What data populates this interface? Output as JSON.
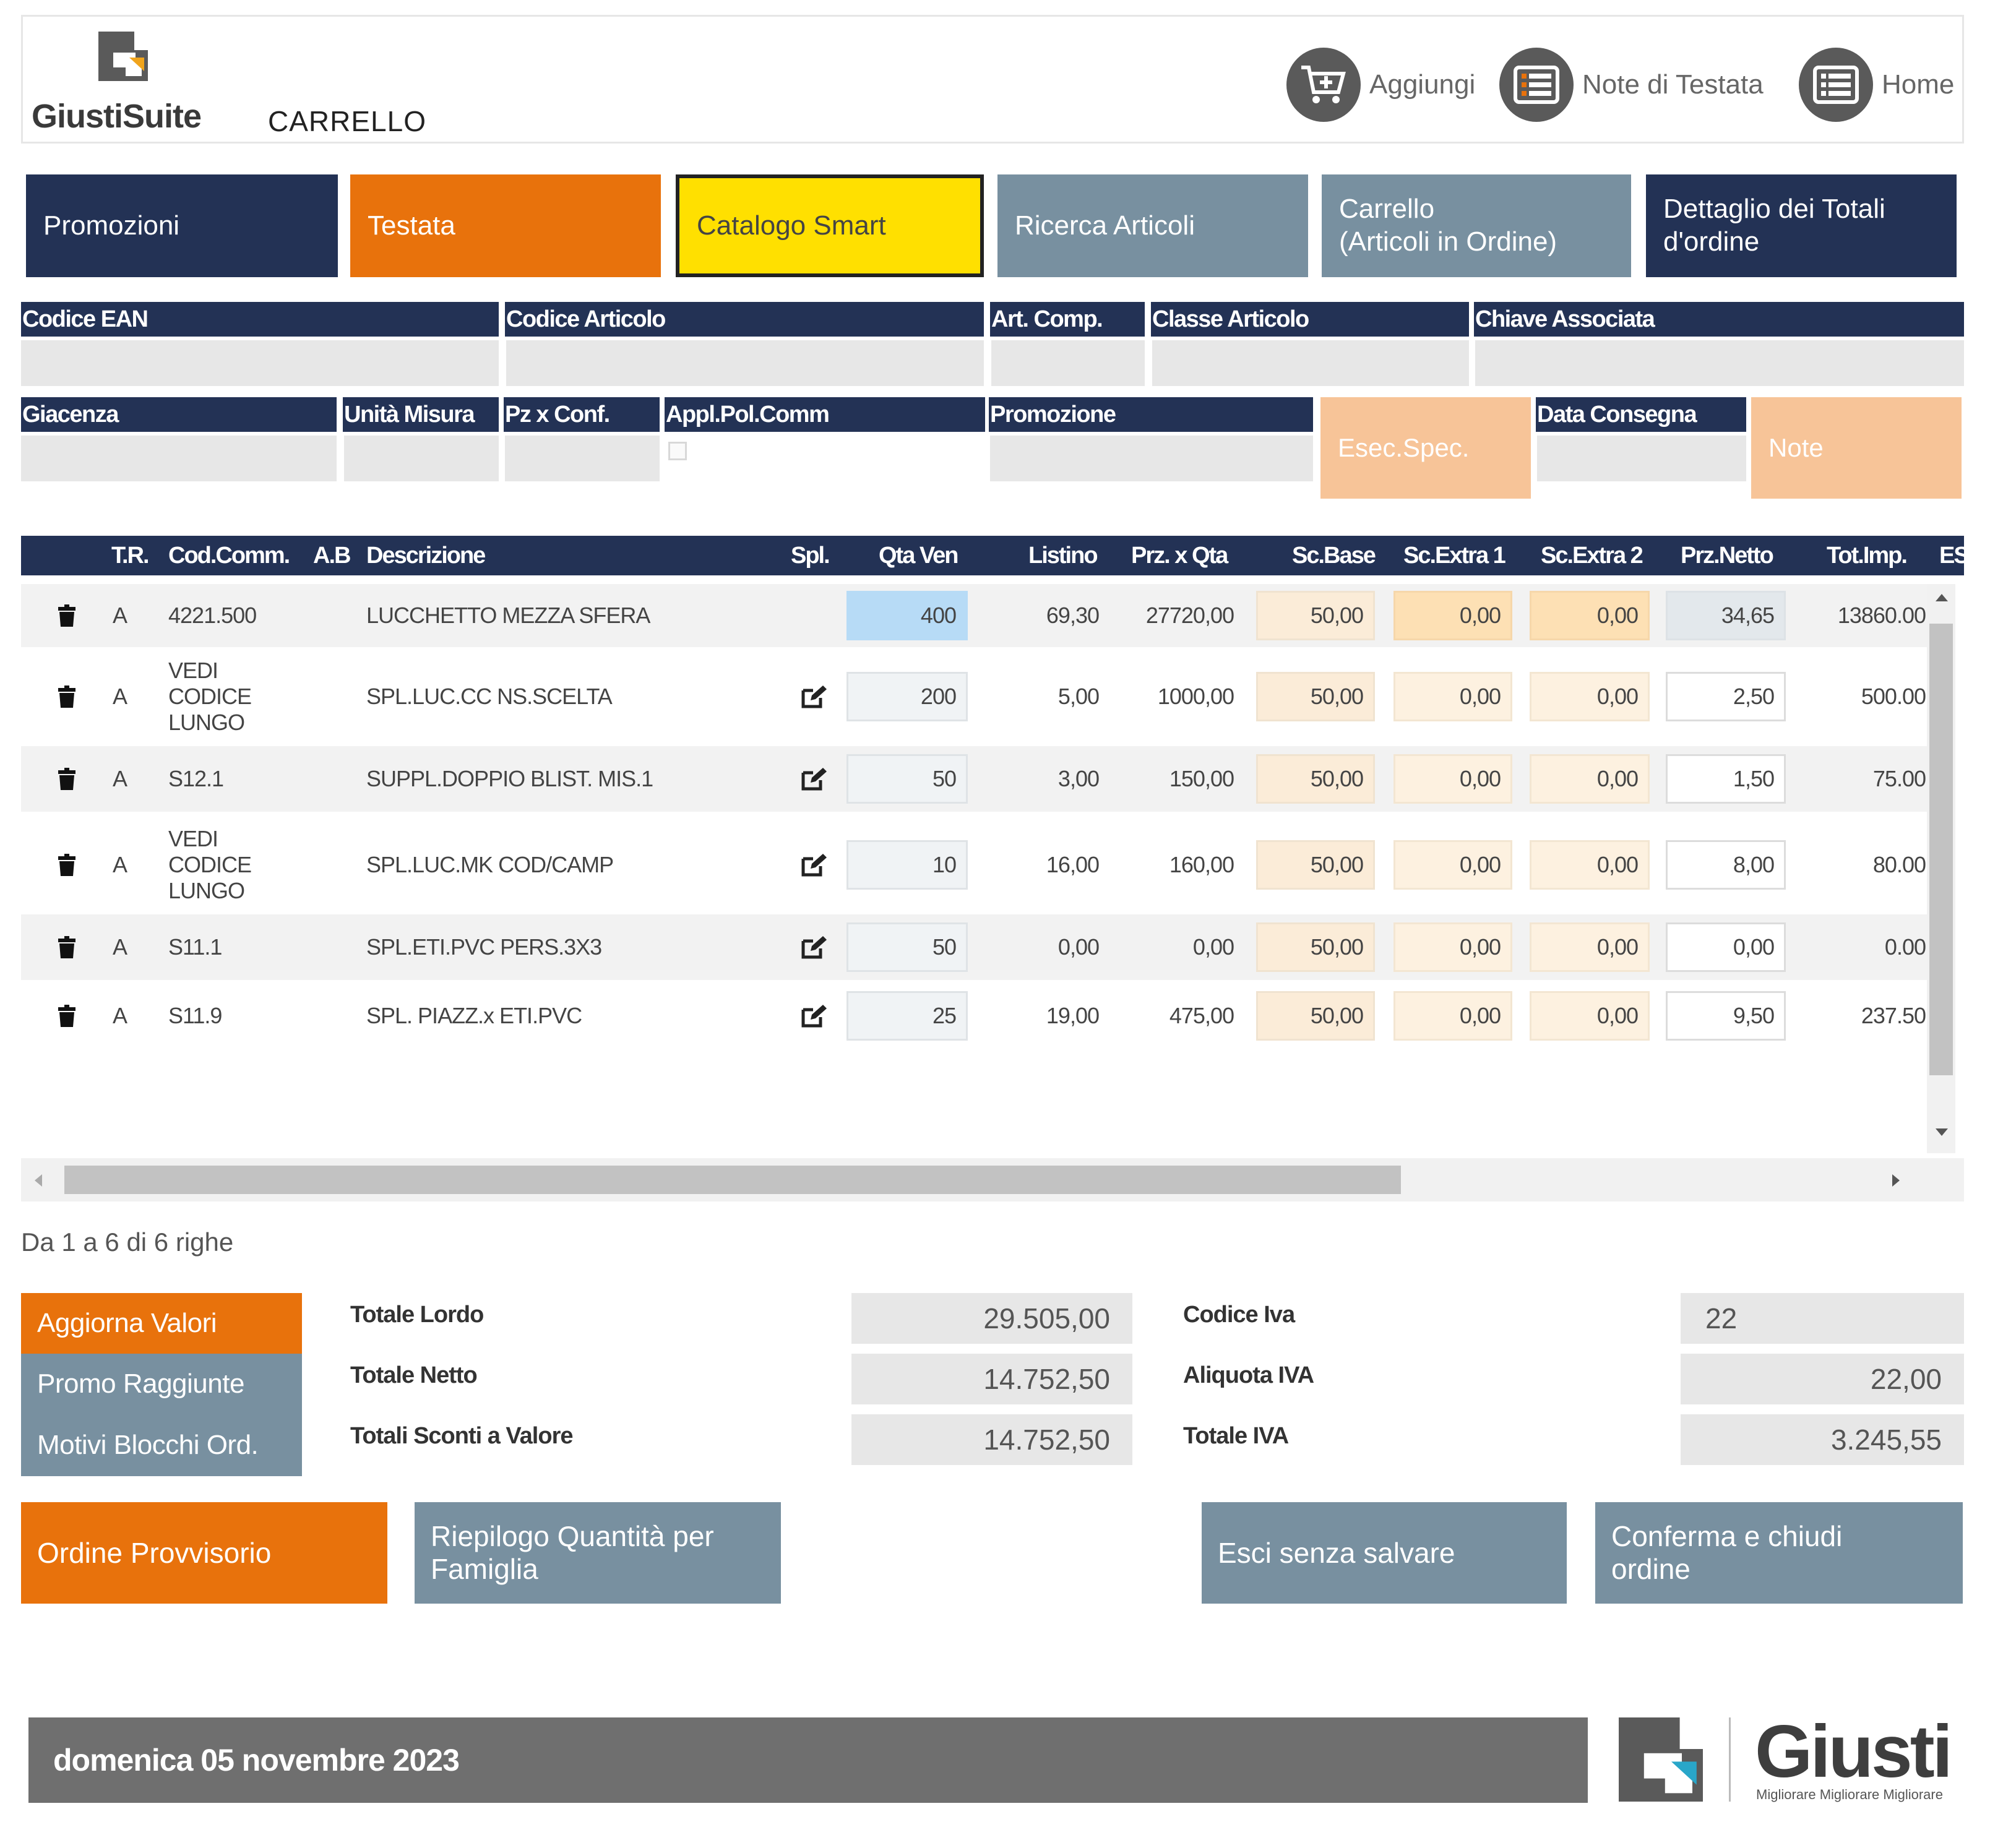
{
  "header": {
    "brand": "GiustiSuite",
    "page_title": "CARRELLO",
    "buttons": [
      {
        "label": "Aggiungi",
        "icon": "cart-add-icon"
      },
      {
        "label": "Note di Testata",
        "icon": "list-icon"
      },
      {
        "label": "Home",
        "icon": "list-icon"
      }
    ]
  },
  "tabs": [
    {
      "label": "Promozioni",
      "color": "#233255"
    },
    {
      "label": "Testata",
      "color": "#e8720c"
    },
    {
      "label": "Catalogo Smart",
      "color": "#ffe000"
    },
    {
      "label": "Ricerca Articoli",
      "color": "#7890a0"
    },
    {
      "label": "Carrello\n(Articoli in Ordine)",
      "color": "#7890a0"
    },
    {
      "label": "Dettaglio dei Totali\nd'ordine",
      "color": "#233255"
    }
  ],
  "fields": {
    "row1": [
      "Codice EAN",
      "Codice Articolo",
      "Art. Comp.",
      "Classe Articolo",
      "Chiave Associata"
    ],
    "row2": [
      "Giacenza",
      "Unità Misura",
      "Pz x Conf.",
      "Appl.Pol.Comm",
      "Promozione",
      "Data Consegna"
    ],
    "esec_spec": "Esec.Spec.",
    "note": "Note"
  },
  "table": {
    "columns": [
      "T.R.",
      "Cod.Comm.",
      "A.B",
      "Descrizione",
      "Spl.",
      "Qta Ven",
      "Listino",
      "Prz. x Qta",
      "Sc.Base",
      "Sc.Extra 1",
      "Sc.Extra 2",
      "Prz.Netto",
      "Tot.Imp.",
      "ES"
    ],
    "rows": [
      {
        "tr": "A",
        "cod": "4221.500",
        "desc": "LUCCHETTO MEZZA SFERA",
        "spl": false,
        "qta": "400",
        "listino": "69,30",
        "prz": "27720,00",
        "base": "50,00",
        "ext1": "0,00",
        "ext2": "0,00",
        "netto": "34,65",
        "tot": "13860.00"
      },
      {
        "tr": "A",
        "cod": "VEDI\nCODICE\nLUNGO",
        "desc": "SPL.LUC.CC NS.SCELTA",
        "spl": true,
        "qta": "200",
        "listino": "5,00",
        "prz": "1000,00",
        "base": "50,00",
        "ext1": "0,00",
        "ext2": "0,00",
        "netto": "2,50",
        "tot": "500.00"
      },
      {
        "tr": "A",
        "cod": "S12.1",
        "desc": "SUPPL.DOPPIO BLIST. MIS.1",
        "spl": true,
        "qta": "50",
        "listino": "3,00",
        "prz": "150,00",
        "base": "50,00",
        "ext1": "0,00",
        "ext2": "0,00",
        "netto": "1,50",
        "tot": "75.00"
      },
      {
        "tr": "A",
        "cod": "VEDI\nCODICE\nLUNGO",
        "desc": "SPL.LUC.MK COD/CAMP",
        "spl": true,
        "qta": "10",
        "listino": "16,00",
        "prz": "160,00",
        "base": "50,00",
        "ext1": "0,00",
        "ext2": "0,00",
        "netto": "8,00",
        "tot": "80.00"
      },
      {
        "tr": "A",
        "cod": "S11.1",
        "desc": "SPL.ETI.PVC PERS.3X3",
        "spl": true,
        "qta": "50",
        "listino": "0,00",
        "prz": "0,00",
        "base": "50,00",
        "ext1": "0,00",
        "ext2": "0,00",
        "netto": "0,00",
        "tot": "0.00"
      },
      {
        "tr": "A",
        "cod": "S11.9",
        "desc": "SPL. PIAZZ.x ETI.PVC",
        "spl": true,
        "qta": "25",
        "listino": "19,00",
        "prz": "475,00",
        "base": "50,00",
        "ext1": "0,00",
        "ext2": "0,00",
        "netto": "9,50",
        "tot": "237.50"
      }
    ],
    "pager": "Da 1 a 6 di 6 righe"
  },
  "side_buttons": [
    {
      "label": "Aggiorna Valori",
      "color": "#e8720c"
    },
    {
      "label": "Promo Raggiunte",
      "color": "#7890a0"
    },
    {
      "label": "Motivi Blocchi Ord.",
      "color": "#7890a0"
    }
  ],
  "totals": {
    "totale_lordo_label": "Totale Lordo",
    "totale_lordo": "29.505,00",
    "totale_netto_label": "Totale Netto",
    "totale_netto": "14.752,50",
    "sconti_label": "Totali Sconti a Valore",
    "sconti": "14.752,50",
    "codice_iva_label": "Codice Iva",
    "codice_iva": "22",
    "aliquota_label": "Aliquota IVA",
    "aliquota": "22,00",
    "totale_iva_label": "Totale IVA",
    "totale_iva": "3.245,55"
  },
  "actions": [
    {
      "label": "Ordine Provvisorio",
      "color": "#e8720c"
    },
    {
      "label": "Riepilogo Quantità per\nFamiglia",
      "color": "#7890a0"
    },
    {
      "label": "Esci senza salvare",
      "color": "#7890a0"
    },
    {
      "label": "Conferma e chiudi\nordine",
      "color": "#7890a0"
    }
  ],
  "footer": {
    "date": "domenica 05 novembre 2023",
    "company": "Giusti",
    "tagline": "Migliorare Migliorare Migliorare"
  },
  "colors": {
    "navy": "#233255",
    "orange": "#e8720c",
    "slate": "#7890a0",
    "yellow": "#ffe000",
    "peach": "#f7c498",
    "accent_cyan": "#29a6c9"
  }
}
